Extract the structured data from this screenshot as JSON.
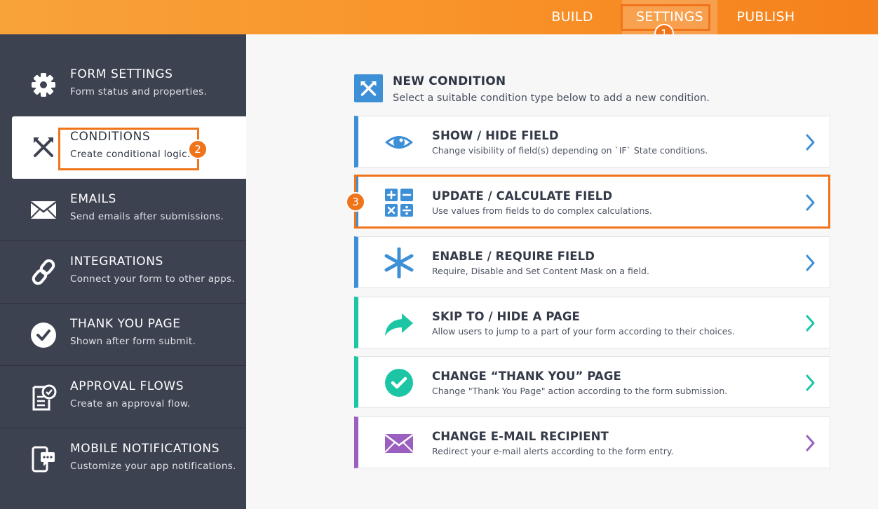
{
  "topnav": {
    "tabs": [
      {
        "label": "BUILD"
      },
      {
        "label": "SETTINGS"
      },
      {
        "label": "PUBLISH"
      }
    ],
    "active": "SETTINGS"
  },
  "annotations": [
    "1",
    "2",
    "3"
  ],
  "sidebar": {
    "items": [
      {
        "title": "FORM SETTINGS",
        "subtitle": "Form status and properties.",
        "icon": "gear-icon"
      },
      {
        "title": "CONDITIONS",
        "subtitle": "Create conditional logic.",
        "icon": "conditions-icon",
        "active": true
      },
      {
        "title": "EMAILS",
        "subtitle": "Send emails after submissions.",
        "icon": "envelope-icon"
      },
      {
        "title": "INTEGRATIONS",
        "subtitle": "Connect your form to other apps.",
        "icon": "link-icon"
      },
      {
        "title": "THANK YOU PAGE",
        "subtitle": "Shown after form submit.",
        "icon": "checkmark-circle-icon"
      },
      {
        "title": "APPROVAL FLOWS",
        "subtitle": "Create an approval flow.",
        "icon": "approval-document-icon"
      },
      {
        "title": "MOBILE NOTIFICATIONS",
        "subtitle": "Customize your app notifications.",
        "icon": "mobile-notification-icon"
      }
    ]
  },
  "header": {
    "title": "NEW CONDITION",
    "subtitle": "Select a suitable condition type below to add a new condition.",
    "icon": "conditions-icon"
  },
  "conditions": [
    {
      "title": "SHOW / HIDE FIELD",
      "subtitle": "Change visibility of field(s) depending on `IF` State conditions.",
      "icon": "eye-icon",
      "color": "#3d8fd6"
    },
    {
      "title": "UPDATE / CALCULATE FIELD",
      "subtitle": "Use values from fields to do complex calculations.",
      "icon": "calculator-icon",
      "color": "#3d8fd6"
    },
    {
      "title": "ENABLE / REQUIRE FIELD",
      "subtitle": "Require, Disable and Set Content Mask on a field.",
      "icon": "asterisk-icon",
      "color": "#3d8fd6"
    },
    {
      "title": "SKIP TO / HIDE A PAGE",
      "subtitle": "Allow users to jump to a part of your form according to their choices.",
      "icon": "forward-arrow-icon",
      "color": "#1cc6a4"
    },
    {
      "title": "CHANGE “THANK YOU” PAGE",
      "subtitle": "Change \"Thank You Page\" action according to the form submission.",
      "icon": "checkmark-circle-icon",
      "color": "#1cc6a4"
    },
    {
      "title": "CHANGE E-MAIL RECIPIENT",
      "subtitle": "Redirect your e-mail alerts according to the form entry.",
      "icon": "envelope-icon",
      "color": "#9b5fc0"
    }
  ],
  "colors": {
    "accent_orange": "#f0741a",
    "sidebar_bg": "#3d4251",
    "blue": "#3d8fd6",
    "teal": "#1cc6a4",
    "purple": "#9b5fc0"
  }
}
